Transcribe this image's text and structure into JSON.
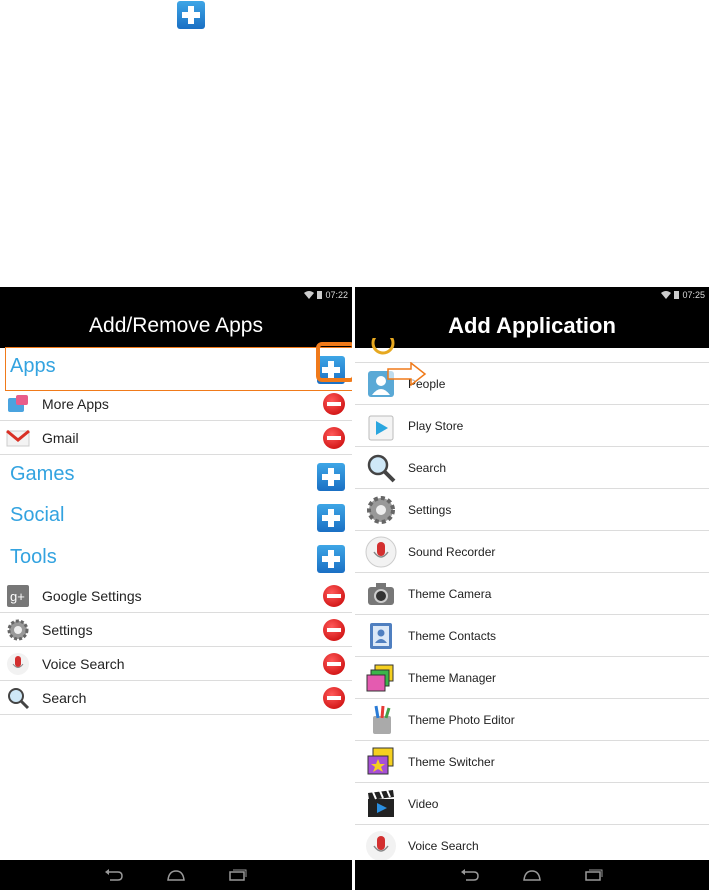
{
  "left_screen": {
    "status": {
      "time": "07:22"
    },
    "title": "Add/Remove Apps",
    "categories": {
      "apps": "Apps",
      "games": "Games",
      "social": "Social",
      "tools": "Tools"
    },
    "apps_items": [
      {
        "label": "More Apps",
        "icon": "more-apps-icon"
      },
      {
        "label": "Gmail",
        "icon": "gmail-icon"
      }
    ],
    "tools_items": [
      {
        "label": "Google Settings",
        "icon": "google-settings-icon"
      },
      {
        "label": "Settings",
        "icon": "settings-gear-icon"
      },
      {
        "label": "Voice Search",
        "icon": "microphone-icon"
      },
      {
        "label": "Search",
        "icon": "magnifier-icon"
      }
    ]
  },
  "right_screen": {
    "status": {
      "time": "07:25"
    },
    "title": "Add Application",
    "items": [
      {
        "label": "People",
        "icon": "people-icon"
      },
      {
        "label": "Play Store",
        "icon": "play-store-icon"
      },
      {
        "label": "Search",
        "icon": "magnifier-icon"
      },
      {
        "label": "Settings",
        "icon": "settings-gear-icon"
      },
      {
        "label": "Sound Recorder",
        "icon": "microphone-icon"
      },
      {
        "label": "Theme Camera",
        "icon": "camera-icon"
      },
      {
        "label": "Theme Contacts",
        "icon": "contacts-book-icon"
      },
      {
        "label": "Theme Manager",
        "icon": "theme-manager-icon"
      },
      {
        "label": "Theme Photo Editor",
        "icon": "photo-editor-icon"
      },
      {
        "label": "Theme Switcher",
        "icon": "theme-switcher-icon"
      },
      {
        "label": "Video",
        "icon": "clapperboard-icon"
      },
      {
        "label": "Voice Search",
        "icon": "microphone-icon"
      }
    ]
  },
  "colors": {
    "accent_blue": "#33a3e0",
    "highlight_orange": "#f07a1a",
    "remove_red": "#d60000"
  }
}
